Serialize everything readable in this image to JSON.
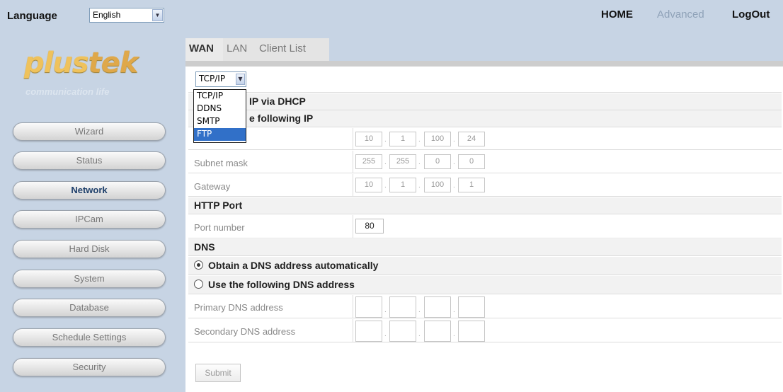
{
  "header": {
    "language_label": "Language",
    "language_value": "English",
    "nav": {
      "home": "HOME",
      "advanced": "Advanced",
      "logout": "LogOut"
    }
  },
  "brand": {
    "logo_plus": "plus",
    "logo_tek": "tek",
    "tagline": "communication life"
  },
  "sidebar": {
    "items": [
      {
        "label": "Wizard"
      },
      {
        "label": "Status"
      },
      {
        "label": "Network"
      },
      {
        "label": "IPCam"
      },
      {
        "label": "Hard Disk"
      },
      {
        "label": "System"
      },
      {
        "label": "Database"
      },
      {
        "label": "Schedule Settings"
      },
      {
        "label": "Security"
      }
    ],
    "active": "Network"
  },
  "tabs": {
    "wan": "WAN",
    "lan": "LAN",
    "client_list": "Client List"
  },
  "protocol_select": {
    "value": "TCP/IP",
    "options": [
      "TCP/IP",
      "DDNS",
      "SMTP",
      "FTP"
    ],
    "highlighted": "FTP"
  },
  "sections": {
    "dhcp": "IP via DHCP",
    "static": "e following IP",
    "http_port": "HTTP Port",
    "dns": "DNS"
  },
  "fields": {
    "ip_label": "IP address",
    "ip": [
      "10",
      "1",
      "100",
      "24"
    ],
    "subnet_label": "Subnet mask",
    "subnet": [
      "255",
      "255",
      "0",
      "0"
    ],
    "gateway_label": "Gateway",
    "gateway": [
      "10",
      "1",
      "100",
      "1"
    ],
    "port_label": "Port number",
    "port": "80"
  },
  "dns": {
    "auto_label": "Obtain a DNS address automatically",
    "manual_label": "Use the following DNS address",
    "primary_label": "Primary DNS address",
    "secondary_label": "Secondary DNS address"
  },
  "submit_label": "Submit"
}
